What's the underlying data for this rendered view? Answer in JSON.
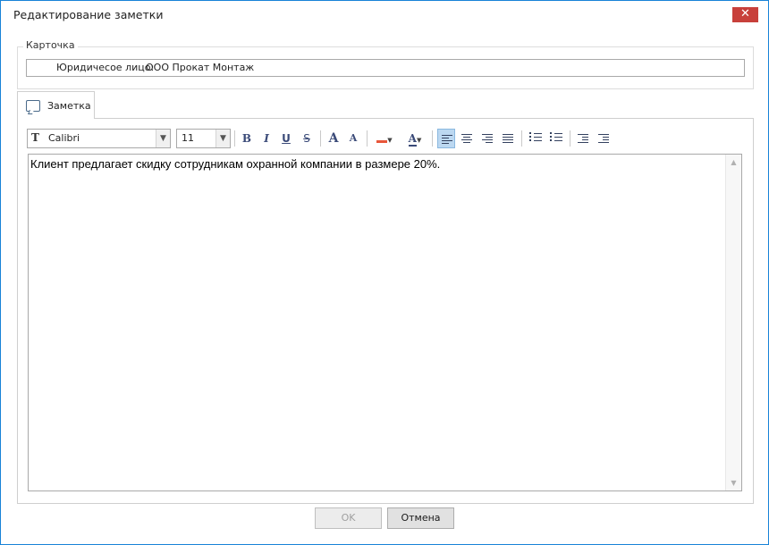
{
  "window": {
    "title": "Редактирование заметки",
    "close_symbol": "✕"
  },
  "card": {
    "legend": "Карточка",
    "entity_label": "Юридичесое лицо:",
    "entity_value": "ООО Прокат Монтаж"
  },
  "tab": {
    "label": "Заметка",
    "icon": "note-icon"
  },
  "toolbar": {
    "font_family": "Calibri",
    "font_size": "11",
    "bold": "B",
    "italic": "I",
    "underline": "U",
    "strike": "S",
    "grow_font": "A",
    "shrink_font": "A",
    "font_color": "A",
    "align_left_active": true
  },
  "editor": {
    "content": "Клиент предлагает скидку сотрудникам охранной компании в размере 20%."
  },
  "buttons": {
    "ok": "OK",
    "cancel": "Отмена"
  },
  "colors": {
    "window_border": "#1883d7",
    "close_button": "#c8403b",
    "active_button": "#bcd8f1",
    "icon_blue": "#3a4a78"
  }
}
